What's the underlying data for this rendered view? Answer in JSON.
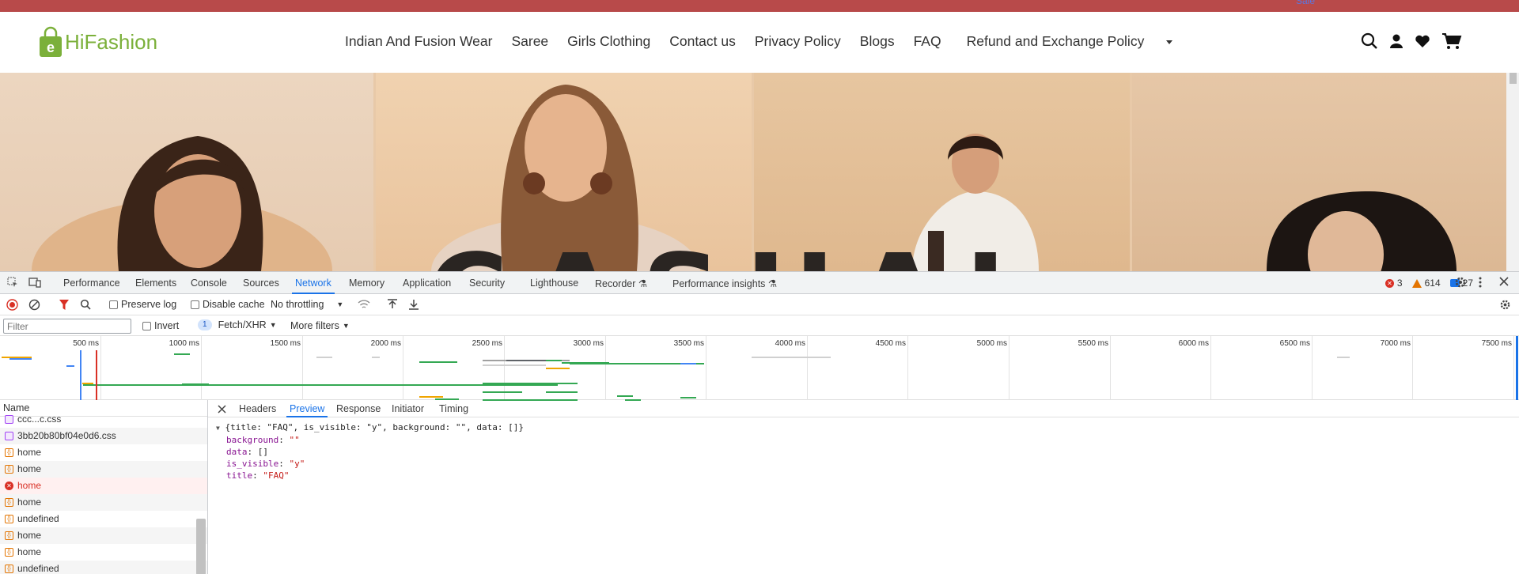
{
  "site": {
    "topbar_text": "Sale",
    "logo_text": "HiFashion",
    "nav": [
      {
        "label": "Indian And Fusion Wear"
      },
      {
        "label": "Saree"
      },
      {
        "label": "Girls Clothing"
      },
      {
        "label": "Contact us"
      },
      {
        "label": "Privacy Policy"
      },
      {
        "label": "Blogs"
      },
      {
        "label": "FAQ"
      },
      {
        "label": "Refund and Exchange Policy"
      }
    ],
    "icons": [
      "search-icon",
      "user-icon",
      "heart-icon",
      "cart-icon"
    ],
    "hero_text": "CASUAL",
    "colors": {
      "topbar": "#b84a4a",
      "brand": "#7bb03a"
    }
  },
  "devtools": {
    "tabs": [
      "Performance",
      "Elements",
      "Console",
      "Sources",
      "Network",
      "Memory",
      "Application",
      "Security",
      "Lighthouse",
      "Recorder",
      "Performance insights"
    ],
    "active_tab": "Network",
    "errors": "3",
    "warnings": "614",
    "messages": "27",
    "toolbar": {
      "preserve_log": "Preserve log",
      "disable_cache": "Disable cache",
      "throttling": "No throttling"
    },
    "filterbar": {
      "filter_placeholder": "Filter",
      "invert": "Invert",
      "badge": "1",
      "fetch_xhr": "Fetch/XHR",
      "more_filters": "More filters"
    },
    "timeline_ticks": [
      "500 ms",
      "1000 ms",
      "1500 ms",
      "2000 ms",
      "2500 ms",
      "3000 ms",
      "3500 ms",
      "4000 ms",
      "4500 ms",
      "5000 ms",
      "5500 ms",
      "6000 ms",
      "6500 ms",
      "7000 ms",
      "7500 ms"
    ],
    "name_header": "Name",
    "requests": [
      {
        "name": "ccc...c.css",
        "type": "css"
      },
      {
        "name": "3bb20b80bf04e0d6.css",
        "type": "css"
      },
      {
        "name": "home",
        "type": "xhr"
      },
      {
        "name": "home",
        "type": "xhr"
      },
      {
        "name": "home",
        "type": "error"
      },
      {
        "name": "home",
        "type": "xhr"
      },
      {
        "name": "undefined",
        "type": "xhr"
      },
      {
        "name": "home",
        "type": "xhr"
      },
      {
        "name": "home",
        "type": "xhr"
      },
      {
        "name": "undefined",
        "type": "xhr"
      }
    ],
    "detail_tabs": [
      "Headers",
      "Preview",
      "Response",
      "Initiator",
      "Timing"
    ],
    "detail_active": "Preview",
    "preview": {
      "summary": "{title: \"FAQ\", is_visible: \"y\", background: \"\", data: []}",
      "lines": [
        {
          "key": "background",
          "value": "\"\""
        },
        {
          "key": "data",
          "value": "[]"
        },
        {
          "key": "is_visible",
          "value": "\"y\""
        },
        {
          "key": "title",
          "value": "\"FAQ\""
        }
      ]
    }
  }
}
